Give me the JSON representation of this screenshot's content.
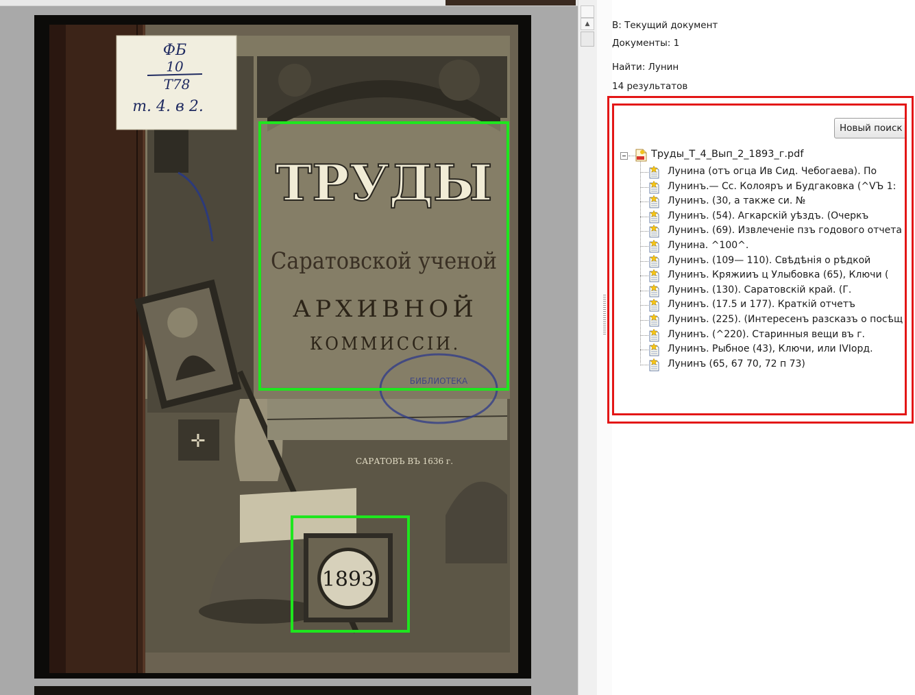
{
  "viewer": {
    "cover": {
      "shelf_label": [
        "ФБ",
        "10",
        "Т78",
        "т. 4. в 2."
      ],
      "title_lines": [
        "ТРУДЫ",
        "Саратовской ученой",
        "АРХИВНОЙ",
        "КОММИССІИ."
      ],
      "stamp_text": "БИБЛИОТЕКА",
      "city_caption": "САРАТОВЪ ВЪ 1636 г.",
      "year": "1893"
    },
    "highlight_color": "#1ee61e"
  },
  "search": {
    "scope": "В: Текущий документ",
    "documents": "Документы: 1",
    "query": "Найти: Лунин",
    "results_count": "14 результатов",
    "new_search_label": "Новый поиск",
    "root_file": "Труды_Т_4_Вып_2_1893_г.pdf",
    "results": [
      "Лунина (отъ огца Ив Сид. Чебогаева). По",
      "Лунинъ.— Сс. Колояръ и Будгаковка (^VЪ 1:",
      "Лунинъ. (30, а также си. №",
      "Лунинъ. (54). Агкарскій уѣздъ. (Очеркъ",
      "Лунинъ. (69). Извлеченіе пзъ годового отчета",
      "Лунина. ^100^.",
      "Лунинъ. (109— 110). Свѣдѣнія о рѣдкой",
      "Лунинъ. Кряжииъ ц Улыбовка (65), Ключи (",
      "Лунинъ. (130). Саратовскій край. (Г.",
      "Лунинъ. (17.5 и 177). Краткій отчетъ",
      "Лунинъ. (225). (Интересенъ разсказъ о посѣщ",
      "Лунинъ. (^220). Старинныя вещи въ г.",
      "Лунинъ. Рыбное (43), Ключи, или IVIорд.",
      "Лунинъ (65, 67 70, 72 п 73)"
    ],
    "outline_color": "#e31616"
  }
}
